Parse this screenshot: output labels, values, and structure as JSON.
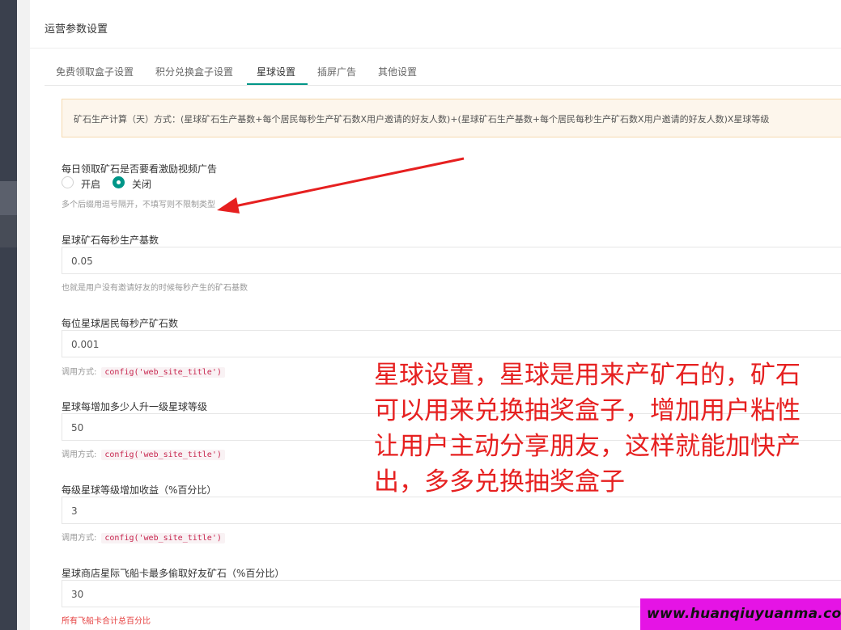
{
  "panel": {
    "title": "运营参数设置"
  },
  "tabs": [
    {
      "label": "免费领取盒子设置"
    },
    {
      "label": "积分兑换盒子设置"
    },
    {
      "label": "星球设置"
    },
    {
      "label": "插屏广告"
    },
    {
      "label": "其他设置"
    }
  ],
  "notice": {
    "text": "矿石生产计算（天）方式：(星球矿石生产基数+每个居民每秒生产矿石数X用户邀请的好友人数)+(星球矿石生产基数+每个居民每秒生产矿石数X用户邀请的好友人数)X星球等级"
  },
  "form": {
    "ad_watch": {
      "label": "每日领取矿石是否要看激励视频广告",
      "option_on": "开启",
      "option_off": "关闭",
      "selected": "关闭",
      "hint": "多个后缀用逗号隔开，不填写则不限制类型"
    },
    "base_rate": {
      "label": "星球矿石每秒生产基数",
      "value": "0.05",
      "hint": "也就是用户没有邀请好友的时候每秒产生的矿石基数"
    },
    "per_resident": {
      "label": "每位星球居民每秒产矿石数",
      "value": "0.001",
      "hint_prefix": "调用方式:",
      "hint_code": "config('web_site_title')"
    },
    "level_up_people": {
      "label": "星球每增加多少人升一级星球等级",
      "value": "50",
      "hint_prefix": "调用方式:",
      "hint_code": "config('web_site_title')"
    },
    "level_bonus": {
      "label": "每级星球等级增加收益（%百分比）",
      "value": "3",
      "hint_prefix": "调用方式:",
      "hint_code": "config('web_site_title')"
    },
    "steal_max": {
      "label": "星球商店星际飞船卡最多偷取好友矿石（%百分比）",
      "value": "30",
      "hint": "所有飞船卡合计总百分比"
    }
  },
  "overlay": {
    "lines": [
      "星球设置，星球是用来产矿石的，矿石",
      "可以用来兑换抽奖盒子，增加用户粘性",
      "让用户主动分享朋友，这样就能加快产",
      "出，多多兑换抽奖盒子"
    ]
  },
  "watermark": {
    "text": "www.huanqiuyuanma.com"
  },
  "colors": {
    "accent": "#009688",
    "annotation": "#e62020",
    "watermark_bg": "#e514e5"
  }
}
